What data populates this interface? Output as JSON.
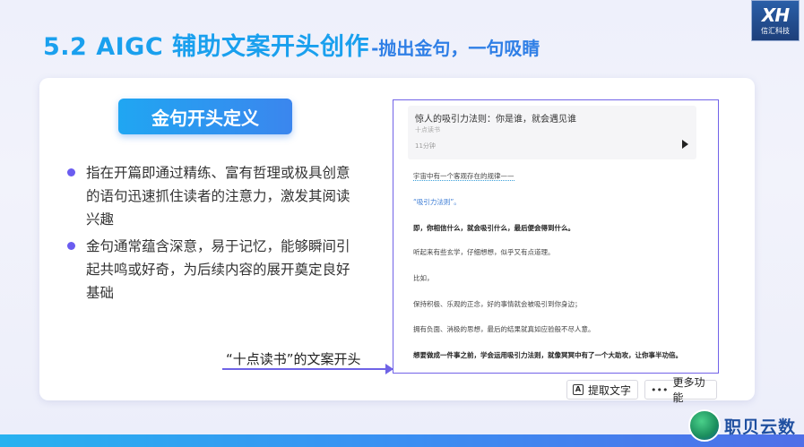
{
  "slide": {
    "title_main": "5.2 AIGC 辅助文案开头创作",
    "title_sub": "-抛出金句，一句吸睛",
    "badge": "金句开头定义",
    "bullets": [
      "指在开篇即通过精练、富有哲理或极具创意的语句迅速抓住读者的注意力，激发其阅读兴趣",
      "金句通常蕴含深意，易于记忆，能够瞬间引起共鸣或好奇，为后续内容的展开奠定良好基础"
    ],
    "caption": "“十点读书”的文案开头"
  },
  "logo": {
    "mark": "XH",
    "name": "信汇科技"
  },
  "article": {
    "audio_title": "惊人的吸引力法则：你是谁，就会遇见谁",
    "audio_author": "十点读书",
    "audio_duration": "11分钟",
    "lines": [
      "宇宙中有一个客观存在的规律——",
      "“吸引力法则”。",
      "即，你相信什么，就会吸引什么，最后便会得到什么。",
      "听起来有些玄学，仔细想想，似乎又有点道理。",
      "比如，",
      "保持积极、乐观的正念，好的事情就会被吸引到你身边；",
      "拥有负面、消极的思想，最后的结果就真如应验般不尽人意。",
      "想要做成一件事之前，学会运用吸引力法则，就像冥冥中有了一个大助攻，让你事半功倍。"
    ]
  },
  "toolbar": {
    "extract_label": "提取文字",
    "more_label": "更多功能"
  },
  "brand": {
    "name": "职贝云数"
  },
  "colors": {
    "accent": "#1aa0ee",
    "bullet": "#6a5cf0",
    "frame": "#7263e8"
  }
}
